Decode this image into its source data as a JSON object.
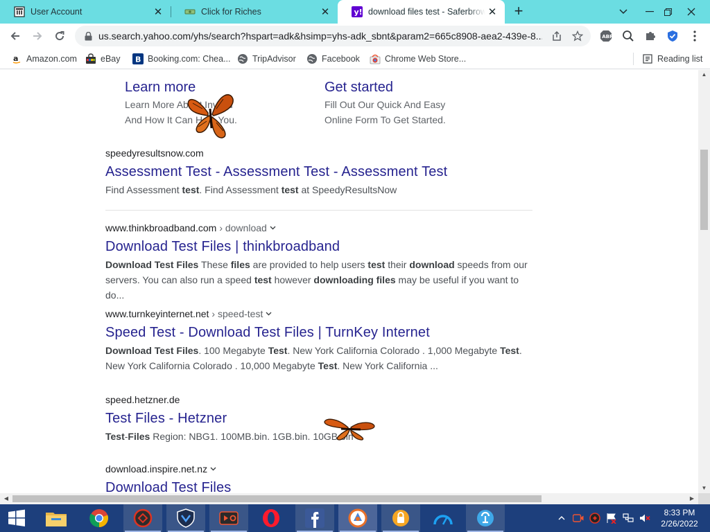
{
  "tabs": [
    {
      "title": "User Account",
      "icon": "bank-icon"
    },
    {
      "title": "Click for Riches",
      "icon": "money-icon"
    },
    {
      "title": "download files test - Saferbrowse",
      "icon": "yahoo-icon",
      "active": true
    }
  ],
  "window_controls": {
    "dropdown": "⌄",
    "minimize": "–",
    "restore": "❐",
    "close": "✕"
  },
  "toolbar": {
    "url": "us.search.yahoo.com/yhs/search?hspart=adk&hsimp=yhs-adk_sbnt&param2=665c8908-aea2-439e-8..."
  },
  "bookmarks": [
    {
      "label": "Amazon.com",
      "icon": "amazon-icon"
    },
    {
      "label": "eBay",
      "icon": "ebay-icon"
    },
    {
      "label": "Booking.com: Chea...",
      "icon": "booking-icon"
    },
    {
      "label": "TripAdvisor",
      "icon": "globe-icon"
    },
    {
      "label": "Facebook",
      "icon": "globe-icon"
    },
    {
      "label": "Chrome Web Store...",
      "icon": "chrome-web-store-icon"
    }
  ],
  "reading_list": "Reading list",
  "sitelinks": [
    {
      "title": "Learn more",
      "desc1": "Learn More About Invalid",
      "desc2": "And How It Can Help You."
    },
    {
      "title": "Get started",
      "desc1": "Fill Out Our Quick And Easy",
      "desc2": "Online Form To Get Started."
    }
  ],
  "results": [
    {
      "domain": "speedyresultsnow.com",
      "path": "",
      "title": "Assessment Test - Assessment Test - Assessment Test",
      "desc": [
        [
          "Find Assessment ",
          false
        ],
        [
          "test",
          true
        ],
        [
          ". Find Assessment ",
          false
        ],
        [
          "test",
          true
        ],
        [
          " at SpeedyResultsNow",
          false
        ]
      ]
    },
    {
      "domain": "www.thinkbroadband.com",
      "path": "› download",
      "title": "Download Test Files | thinkbroadband",
      "desc": [
        [
          "Download Test Files",
          true
        ],
        [
          " These ",
          false
        ],
        [
          "files",
          true
        ],
        [
          " are provided to help users ",
          false
        ],
        [
          "test",
          true
        ],
        [
          " their ",
          false
        ],
        [
          "download",
          true
        ],
        [
          " speeds from our servers. You can also run a speed ",
          false
        ],
        [
          "test",
          true
        ],
        [
          " however ",
          false
        ],
        [
          "downloading files",
          true
        ],
        [
          " may be useful if you want to do...",
          false
        ]
      ]
    },
    {
      "domain": "www.turnkeyinternet.net",
      "path": "› speed-test",
      "title": "Speed Test - Download Test Files | TurnKey Internet",
      "desc": [
        [
          "Download Test Files",
          true
        ],
        [
          ". 100 Megabyte ",
          false
        ],
        [
          "Test",
          true
        ],
        [
          ". New York California Colorado . 1,000 Megabyte ",
          false
        ],
        [
          "Test",
          true
        ],
        [
          ". New York California Colorado . 10,000 Megabyte ",
          false
        ],
        [
          "Test",
          true
        ],
        [
          ". New York California ...",
          false
        ]
      ]
    },
    {
      "domain": "speed.hetzner.de",
      "path": "",
      "title": "Test Files - Hetzner",
      "desc": [
        [
          "Test",
          true
        ],
        [
          "-",
          false
        ],
        [
          "Files",
          true
        ],
        [
          " Region: NBG1. 100MB.bin. 1GB.bin. 10GB.bin",
          false
        ]
      ]
    },
    {
      "domain": "download.inspire.net.nz",
      "path": "",
      "title": "Download Test Files",
      "desc": []
    }
  ],
  "taskbar_apps": [
    {
      "name": "start-button"
    },
    {
      "name": "file-explorer-icon"
    },
    {
      "name": "chrome-icon"
    },
    {
      "name": "game-app-icon"
    },
    {
      "name": "shield-app-icon"
    },
    {
      "name": "video-recorder-icon"
    },
    {
      "name": "opera-icon"
    },
    {
      "name": "facebook-icon"
    },
    {
      "name": "browser-app-icon"
    },
    {
      "name": "vpn-app-icon"
    },
    {
      "name": "speedometer-app-icon"
    },
    {
      "name": "cleaner-app-icon"
    }
  ],
  "clock": {
    "time": "8:33 PM",
    "date": "2/26/2022"
  },
  "colors": {
    "tabstrip": "#6bdde2",
    "link": "#26238f",
    "taskbar": "#1d3f7c"
  }
}
